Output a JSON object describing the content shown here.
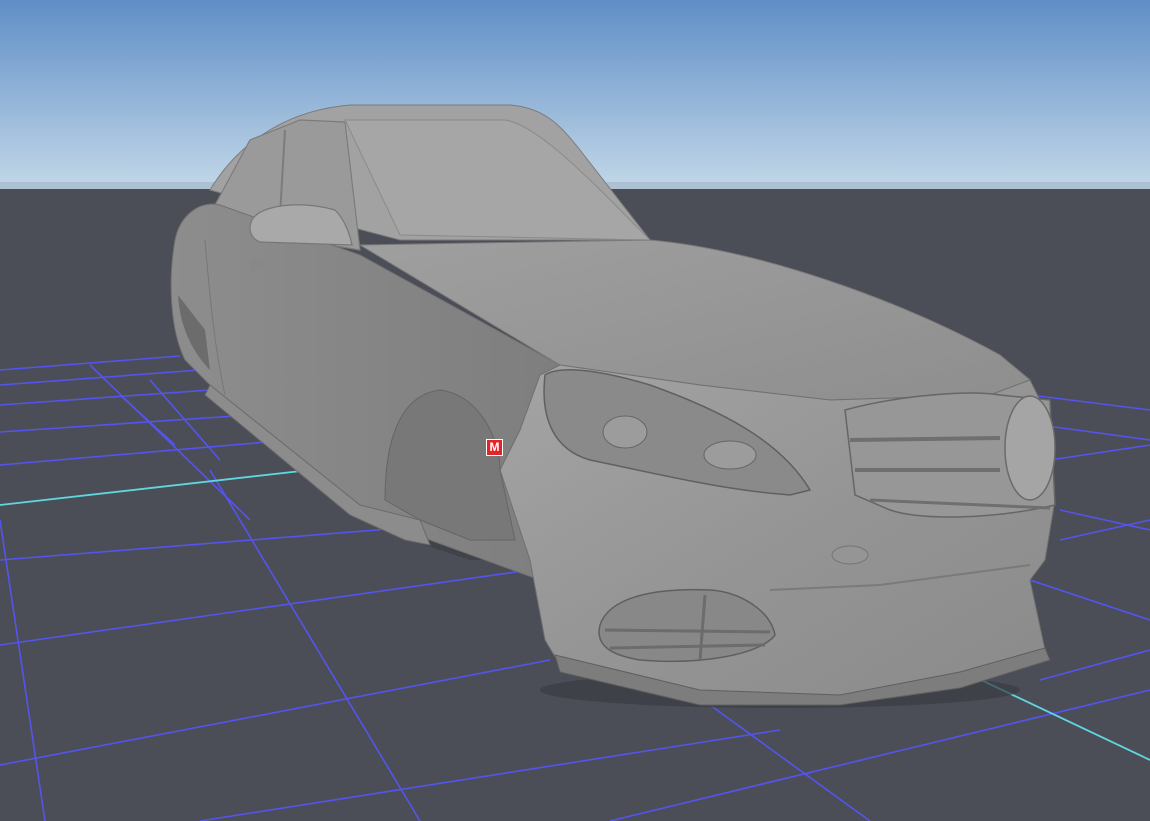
{
  "viewport": {
    "sky_top_color": "#5d8cc5",
    "sky_horizon_color": "#c3d8e8",
    "ground_color": "#4b4e57",
    "grid_color": "#5050f0",
    "grid_axis_color": "#63d8e0",
    "model_color": "#9a9a9a"
  },
  "marker": {
    "label": "M",
    "color": "#e3232a"
  }
}
